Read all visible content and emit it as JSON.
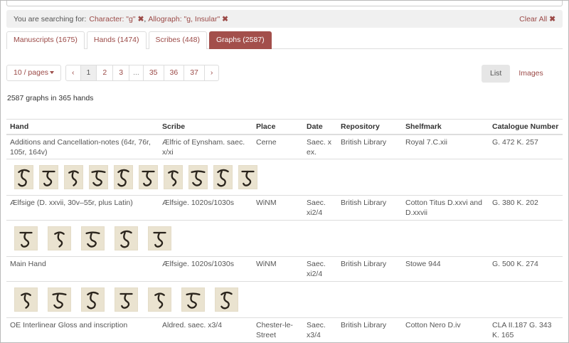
{
  "search": {
    "prefix": "You are searching for:",
    "filters": [
      {
        "label": "Character: \"g\""
      },
      {
        "label": "Allograph: \"g, Insular\""
      }
    ],
    "clear_label": "Clear All"
  },
  "tabs": [
    {
      "label": "Manuscripts (1675)"
    },
    {
      "label": "Hands (1474)"
    },
    {
      "label": "Scribes (448)"
    },
    {
      "label": "Graphs (2587)",
      "active": true
    }
  ],
  "pager": {
    "per_page": "10 / pages",
    "prev": "‹",
    "next": "›",
    "pages": [
      "1",
      "2",
      "3",
      "...",
      "35",
      "36",
      "37"
    ],
    "current": "1"
  },
  "view": {
    "list_label": "List",
    "images_label": "Images",
    "active": "List"
  },
  "summary": "2587 graphs in 365 hands",
  "table": {
    "headers": [
      "Hand",
      "Scribe",
      "Place",
      "Date",
      "Repository",
      "Shelfmark",
      "Catalogue Number"
    ],
    "rows": [
      {
        "hand": "Additions and Cancellation-notes (64r, 76r, 105r, 164v)",
        "scribe": "Ælfric of Eynsham. saec. x/xi",
        "place": "Cerne",
        "date": "Saec. x ex.",
        "repository": "British Library",
        "shelfmark": "Royal 7.C.xii",
        "catalogue": "G. 472 K. 257",
        "thumb_count": 10
      },
      {
        "hand": "Ælfsige (D. xxvii, 30v–55r, plus Latin)",
        "scribe": "Ælfsige. 1020s/1030s",
        "place": "WiNM",
        "date": "Saec. xi2/4",
        "repository": "British Library",
        "shelfmark": "Cotton Titus D.xxvi and D.xxvii",
        "catalogue": "G. 380 K. 202",
        "thumb_count": 5
      },
      {
        "hand": "Main Hand",
        "scribe": "Ælfsige. 1020s/1030s",
        "place": "WiNM",
        "date": "Saec. xi2/4",
        "repository": "British Library",
        "shelfmark": "Stowe 944",
        "catalogue": "G. 500 K. 274",
        "thumb_count": 7
      },
      {
        "hand": "OE Interlinear Gloss and inscription",
        "scribe": "Aldred. saec. x3/4",
        "place": "Chester-le-Street",
        "date": "Saec. x3/4",
        "repository": "British Library",
        "shelfmark": "Cotton Nero D.iv",
        "catalogue": "CLA II.187 G. 343 K. 165",
        "thumb_count": 0
      }
    ]
  },
  "colors": {
    "accent": "#a34f4b",
    "link": "#9b4a47",
    "parchment": "#eae3d0",
    "ink": "#2a241c"
  }
}
